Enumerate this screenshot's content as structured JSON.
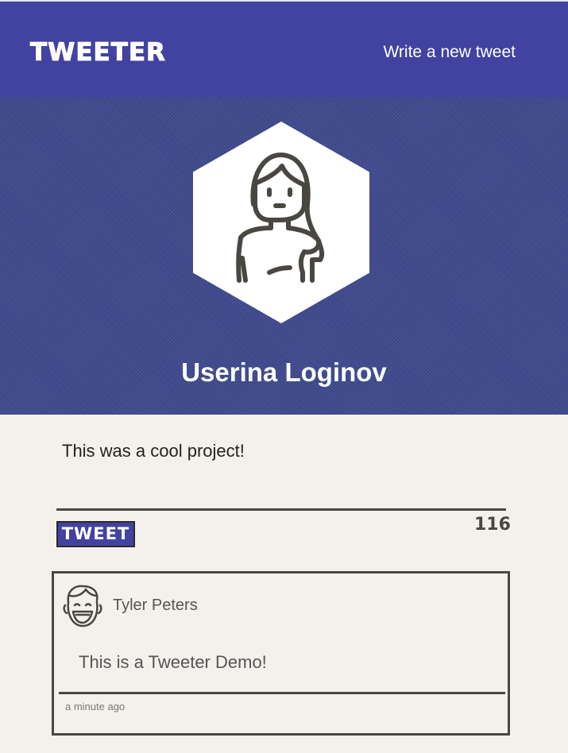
{
  "nav": {
    "brand": "TWEETER",
    "compose_link": "Write a new tweet"
  },
  "profile": {
    "name": "Userina Loginov",
    "avatar_icon": "woman-avatar-icon"
  },
  "compose": {
    "text": "This was a cool project!",
    "button_label": "TWEET",
    "counter": "116"
  },
  "tweets": [
    {
      "author": "Tyler Peters",
      "avatar_icon": "smiling-boy-avatar-icon",
      "body": "This is a Tweeter Demo!",
      "time": "a minute ago"
    }
  ],
  "colors": {
    "nav_bg": "#4242a0",
    "header_bg": "#3f4a8e",
    "page_bg": "#f4f1ec",
    "rule": "#4a4742"
  }
}
